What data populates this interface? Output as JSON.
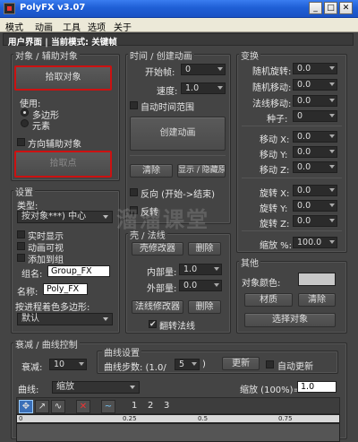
{
  "window": {
    "title": "PolyFX v3.07"
  },
  "menu": [
    "模式",
    "动画",
    "工具",
    "选项",
    "关于"
  ],
  "header": {
    "text": "用户界面 | 当前模式: 关键帧"
  },
  "objects": {
    "title": "对象 / 辅助对象",
    "pick_object": "拾取对象",
    "use_label": "使用:",
    "use_options": [
      "多边形",
      "元素"
    ],
    "direction_helper": "方向辅助对象",
    "pick_point": "拾取点"
  },
  "timing": {
    "title": "时间 / 创建动画",
    "start_frame_label": "开始帧:",
    "start_frame_value": "0",
    "speed_label": "速度:",
    "speed_value": "1.0",
    "auto_range": "自动时间范围",
    "create_anim": "创建动画",
    "clear": "清除",
    "show_hide": "显示 / 隐藏原对",
    "reverse": "反向 (开始->结束)",
    "flip": "反转"
  },
  "transform": {
    "title": "变换",
    "random_rotate_label": "随机旋转:",
    "random_rotate_value": "0.0",
    "random_move_label": "随机移动:",
    "random_move_value": "0.0",
    "normal_move_label": "法线移动:",
    "normal_move_value": "0.0",
    "seed_label": "种子:",
    "seed_value": "0",
    "move_x_label": "移动 X:",
    "move_y_label": "移动 Y:",
    "move_z_label": "移动 Z:",
    "move_values": [
      "0.0",
      "0.0",
      "0.0"
    ],
    "rot_x_label": "旋转 X:",
    "rot_y_label": "旋转 Y:",
    "rot_z_label": "旋转 Z:",
    "rot_values": [
      "0.0",
      "0.0",
      "0.0"
    ],
    "scale_label": "缩放 %:",
    "scale_value": "100.0"
  },
  "settings": {
    "title": "设置",
    "type_label": "类型:",
    "type_value": "按对象***) 中心",
    "realtime": "实时显示",
    "anim_visible": "动画可视",
    "add_to_group": "添加到组",
    "group_name_label": "组名:",
    "group_name_value": "Group_FX",
    "name_label": "名称:",
    "name_value": "Poly_FX",
    "color_label": "按进程着色多边形:",
    "color_value": "默认"
  },
  "shell": {
    "title": "壳 / 法线",
    "shell_mod": "壳修改器",
    "delete1": "删除",
    "inner_label": "内部量:",
    "inner_value": "1.0",
    "outer_label": "外部量:",
    "outer_value": "0.0",
    "normal_mod": "法线修改器",
    "delete2": "删除",
    "flip_normal": "翻转法线"
  },
  "other": {
    "title": "其他",
    "obj_color_label": "对象颜色:",
    "material": "材质",
    "clear": "清除",
    "select_obj": "选择对象"
  },
  "decay": {
    "title": "衰减 / 曲线控制",
    "decay_label": "衰减:",
    "decay_value": "10",
    "curve_label": "曲线:",
    "curve_value": "缩放",
    "curve_settings_title": "曲线设置",
    "curve_steps_label": "曲线步数: (1.0/",
    "curve_steps_value": "5",
    "curve_steps_suffix": ")",
    "update": "更新",
    "auto_update": "自动更新",
    "scale_label": "缩放 (100%)=",
    "scale_value": "1.0"
  },
  "toolbar": {
    "tools": [
      "move-points-icon",
      "insert-point-icon",
      "corner-icon",
      "delete-point-icon",
      "wave-icon"
    ],
    "numbers": [
      "1",
      "2",
      "3"
    ]
  },
  "ruler_ticks": [
    "0",
    "0.25",
    "0.5",
    "0.75"
  ],
  "watermark": "溜溜课堂"
}
